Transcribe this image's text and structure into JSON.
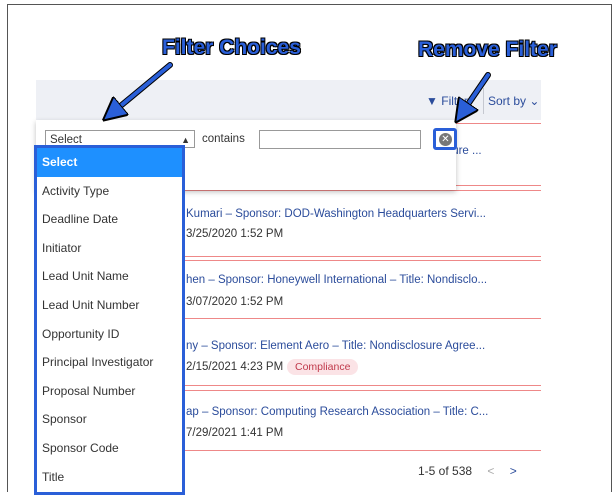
{
  "callouts": {
    "filter_choices": "Filter Choices",
    "remove_filter": "Remove Filter"
  },
  "toolbar": {
    "filter_label": "Filter",
    "filter_icon": "funnel-icon",
    "sort_label": "Sort by",
    "sort_icon": "chevron-down-icon"
  },
  "filter": {
    "field_selected": "Select",
    "operator": "contains",
    "value": "",
    "remove_icon": "circle-x-icon"
  },
  "dropdown": {
    "options": [
      "Select",
      "Activity Type",
      "Deadline Date",
      "Initiator",
      "Lead Unit Name",
      "Lead Unit Number",
      "Opportunity ID",
      "Principal Investigator",
      "Proposal Number",
      "Sponsor",
      "Sponsor Code",
      "Title"
    ]
  },
  "rows": [
    {
      "title": "sclosure ...",
      "date": ""
    },
    {
      "title": "Kumari – Sponsor: DOD-Washington Headquarters Servi...",
      "date": "3/25/2020 1:52 PM"
    },
    {
      "title": "hen – Sponsor: Honeywell International – Title: Nondisclo...",
      "date": "3/07/2020 1:52 PM"
    },
    {
      "title": "ny – Sponsor: Element Aero – Title: Nondisclosure Agree...",
      "date": "2/15/2021 4:23 PM",
      "badge": "Compliance"
    },
    {
      "title": "ap – Sponsor: Computing Research Association – Title: C...",
      "date": "7/29/2021 1:41 PM"
    }
  ],
  "pager": {
    "range": "1-5 of 538",
    "prev": "<",
    "next": ">"
  },
  "colors": {
    "accent": "#2a5fd8",
    "link": "#2b4c9b",
    "selected_option": "#1e90ff",
    "badge_bg": "#fbe3e6",
    "badge_text": "#c0394b"
  }
}
